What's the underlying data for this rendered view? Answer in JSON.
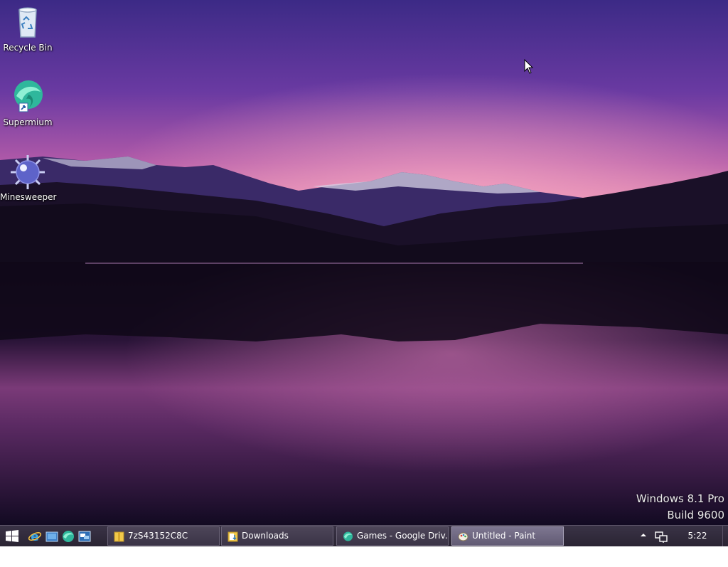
{
  "desktop": {
    "icons": [
      {
        "label": "Recycle Bin",
        "icon": "recycle-bin-icon"
      },
      {
        "label": "Supermium",
        "icon": "supermium-icon"
      },
      {
        "label": "Minesweeper",
        "icon": "minesweeper-icon"
      }
    ],
    "watermark": {
      "line1": "Windows 8.1 Pro",
      "line2": "Build 9600"
    }
  },
  "taskbar": {
    "start_icon": "windows-logo-icon",
    "quick_launch": [
      {
        "icon": "internet-explorer-icon"
      },
      {
        "icon": "show-desktop-icon"
      },
      {
        "icon": "supermium-icon"
      },
      {
        "icon": "window-switcher-icon"
      }
    ],
    "tasks": [
      {
        "label": "7zS43152C8C",
        "icon": "folder-zip-icon",
        "active": false
      },
      {
        "label": "Downloads",
        "icon": "folder-icon",
        "active": false
      },
      {
        "label": "Games - Google Driv...",
        "icon": "supermium-icon",
        "active": false
      },
      {
        "label": "Untitled - Paint",
        "icon": "paint-icon",
        "active": true
      }
    ],
    "tray": {
      "chevron_icon": "chevron-up-icon",
      "network_icon": "network-icon",
      "clock": "5:22 PM"
    }
  },
  "colors": {
    "sky_top": "#4a2f8f",
    "sky_glow": "#e38bb8",
    "water": "#1a0d2b",
    "taskbar": "#2f2939"
  }
}
